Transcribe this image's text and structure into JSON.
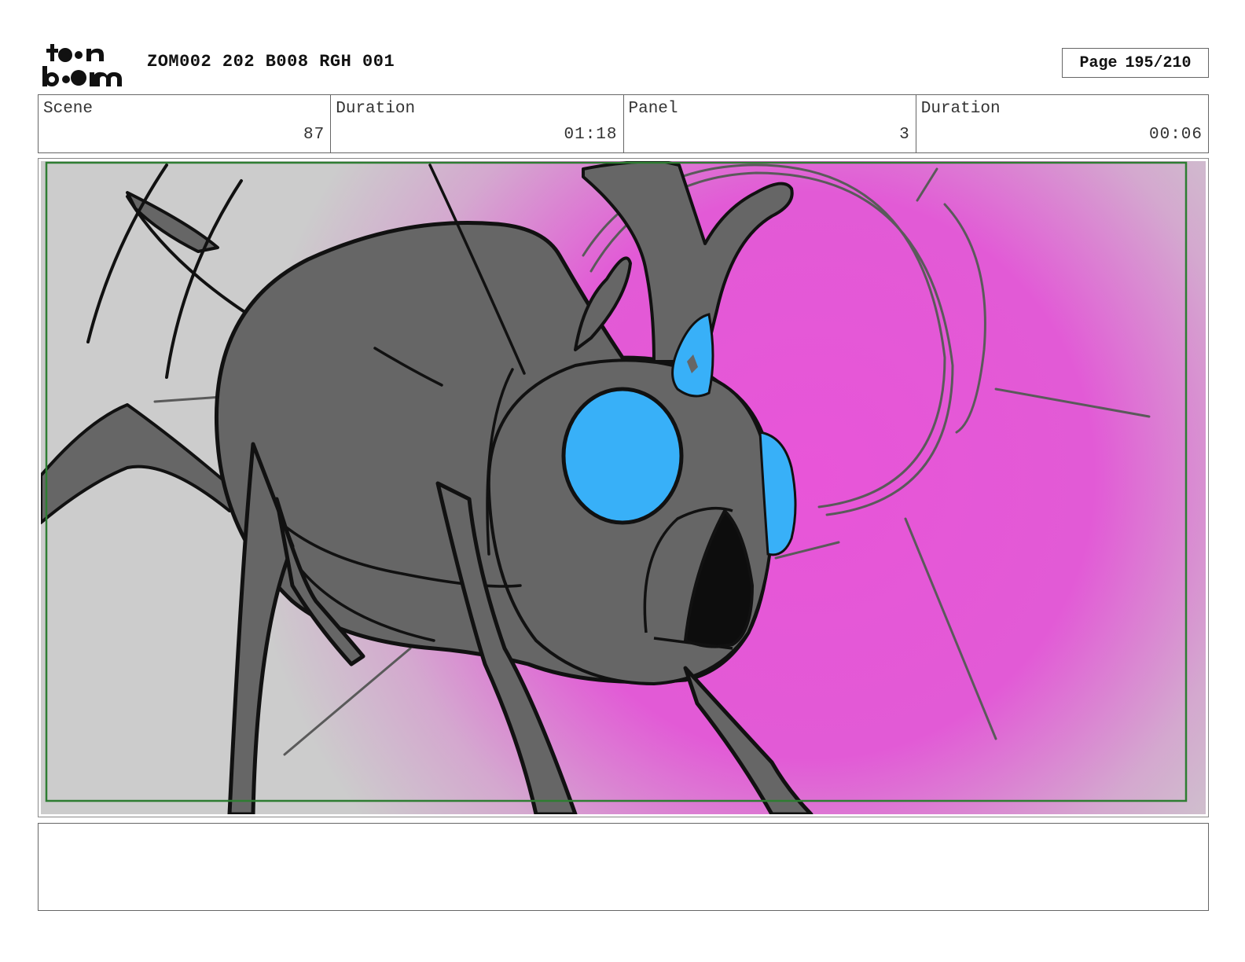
{
  "header": {
    "logo_icon": "toonboom-logo",
    "project_title": "ZOM002 202 B008 RGH 001",
    "page_label": "Page",
    "page_number": "195/210"
  },
  "info": {
    "scene": {
      "label": "Scene",
      "value": "87"
    },
    "scene_duration": {
      "label": "Duration",
      "value": "01:18"
    },
    "panel": {
      "label": "Panel",
      "value": "3"
    },
    "panel_duration": {
      "label": "Duration",
      "value": "00:06"
    }
  },
  "panel_image": {
    "description_icon": "storyboard-sketch-creature",
    "colors": {
      "background": "#cccccc",
      "glow": "#e855d8",
      "body": "#666666",
      "eye": "#38b0f8",
      "safe_area": "#2e7d32"
    }
  },
  "notes": {
    "text": ""
  }
}
